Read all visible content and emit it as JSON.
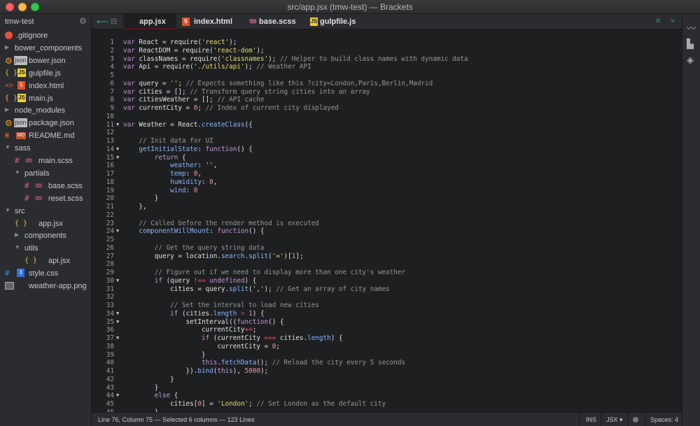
{
  "window": {
    "title": "src/app.jsx (tmw-test) — Brackets"
  },
  "sidebar": {
    "project": "tmw-test",
    "items": [
      {
        "label": ".gitignore",
        "icon": "git-icon"
      },
      {
        "label": "bower_components",
        "icon": "folder-closed"
      },
      {
        "label": "bower.json",
        "icon": "json-icon",
        "badge": "json"
      },
      {
        "label": "gulpfile.js",
        "icon": "js-icon",
        "badge": "JS"
      },
      {
        "label": "index.html",
        "icon": "html-icon",
        "badge": "<>"
      },
      {
        "label": "main.js",
        "icon": "js-icon",
        "badge": "JS"
      },
      {
        "label": "node_modules",
        "icon": "folder-closed"
      },
      {
        "label": "package.json",
        "icon": "json-icon",
        "badge": "json"
      },
      {
        "label": "README.md",
        "icon": "markdown-icon",
        "badge": "MD"
      },
      {
        "label": "sass",
        "icon": "folder-open"
      },
      {
        "label": "main.scss",
        "icon": "sass-icon"
      },
      {
        "label": "partials",
        "icon": "folder-open"
      },
      {
        "label": "base.scss",
        "icon": "sass-icon"
      },
      {
        "label": "reset.scss",
        "icon": "sass-icon"
      },
      {
        "label": "src",
        "icon": "folder-open"
      },
      {
        "label": "app.jsx",
        "icon": "jsx-icon"
      },
      {
        "label": "components",
        "icon": "folder-closed"
      },
      {
        "label": "utils",
        "icon": "folder-open"
      },
      {
        "label": "api.jsx",
        "icon": "jsx-icon"
      },
      {
        "label": "style.css",
        "icon": "css-icon"
      },
      {
        "label": "weather-app.png",
        "icon": "image-icon"
      }
    ]
  },
  "tabs": [
    {
      "label": "app.jsx",
      "active": true
    },
    {
      "label": "index.html",
      "active": false
    },
    {
      "label": "base.scss",
      "active": false
    },
    {
      "label": "gulpfile.js",
      "active": false
    }
  ],
  "editor": {
    "lines": [
      {
        "n": "1",
        "fold": "",
        "html": "<span class='k'>var</span> React = require(<span class='s'>'react'</span>);"
      },
      {
        "n": "2",
        "fold": "",
        "html": "<span class='k'>var</span> ReactDOM = require(<span class='s'>'react-dom'</span>);"
      },
      {
        "n": "3",
        "fold": "",
        "html": "<span class='k'>var</span> classNames = require(<span class='s'>'classnames'</span>); <span class='c'>// Helper to build class names with dynamic data</span>"
      },
      {
        "n": "4",
        "fold": "",
        "html": "<span class='k'>var</span> Api = require(<span class='s'>'./utils/api'</span>); <span class='c'>// Weather API</span>"
      },
      {
        "n": "5",
        "fold": "",
        "html": ""
      },
      {
        "n": "6",
        "fold": "",
        "html": "<span class='k'>var</span> query = <span class='s'>''</span>; <span class='c'>// Expects something like this ?city=London,Paris,Berlin,Madrid</span>"
      },
      {
        "n": "7",
        "fold": "",
        "html": "<span class='k'>var</span> cities = []; <span class='c'>// Transform query string cities into an array</span>"
      },
      {
        "n": "8",
        "fold": "",
        "html": "<span class='k'>var</span> citiesWeather = []; <span class='c'>// API cache</span>"
      },
      {
        "n": "9",
        "fold": "",
        "html": "<span class='k'>var</span> currentCity = <span class='n'>0</span>; <span class='c'>// Index of current city displayed</span>"
      },
      {
        "n": "10",
        "fold": "",
        "html": ""
      },
      {
        "n": "11",
        "fold": "▼",
        "html": "<span class='k'>var</span> Weather = React.<span class='f'>createClass</span>({"
      },
      {
        "n": "12",
        "fold": "",
        "html": ""
      },
      {
        "n": "13",
        "fold": "",
        "html": "    <span class='c'>// Init data for UI</span>"
      },
      {
        "n": "14",
        "fold": "▼",
        "html": "    <span class='f'>getInitialState</span>: <span class='k'>function</span>() {"
      },
      {
        "n": "15",
        "fold": "▼",
        "html": "        <span class='k'>return</span> {"
      },
      {
        "n": "16",
        "fold": "",
        "html": "            <span class='f'>weather</span>: <span class='s'>''</span>,"
      },
      {
        "n": "17",
        "fold": "",
        "html": "            <span class='f'>temp</span>: <span class='n'>0</span>,"
      },
      {
        "n": "18",
        "fold": "",
        "html": "            <span class='f'>humidity</span>: <span class='n'>0</span>,"
      },
      {
        "n": "19",
        "fold": "",
        "html": "            <span class='f'>wind</span>: <span class='n'>0</span>"
      },
      {
        "n": "20",
        "fold": "",
        "html": "        }"
      },
      {
        "n": "21",
        "fold": "",
        "html": "    },"
      },
      {
        "n": "22",
        "fold": "",
        "html": ""
      },
      {
        "n": "23",
        "fold": "",
        "html": "    <span class='c'>// Called before the render method is executed</span>"
      },
      {
        "n": "24",
        "fold": "▼",
        "html": "    <span class='f'>componentWillMount</span>: <span class='k'>function</span>() {"
      },
      {
        "n": "25",
        "fold": "",
        "html": ""
      },
      {
        "n": "26",
        "fold": "",
        "html": "        <span class='c'>// Get the query string data</span>"
      },
      {
        "n": "27",
        "fold": "",
        "html": "        query = location.<span class='f'>search</span>.<span class='f'>split</span>(<span class='s'>'='</span>)[<span class='n'>1</span>];"
      },
      {
        "n": "28",
        "fold": "",
        "html": ""
      },
      {
        "n": "29",
        "fold": "",
        "html": "        <span class='c'>// Figure out if we need to display more than one city's weather</span>"
      },
      {
        "n": "30",
        "fold": "▼",
        "html": "        <span class='k'>if</span> (query <span class='o'>!==</span> <span class='k'>undefined</span>) {"
      },
      {
        "n": "31",
        "fold": "",
        "html": "            cities = query.<span class='f'>split</span>(<span class='s'>','</span>); <span class='c'>// Get an array of city names</span>"
      },
      {
        "n": "32",
        "fold": "",
        "html": ""
      },
      {
        "n": "33",
        "fold": "",
        "html": "            <span class='c'>// Set the interval to load new cities</span>"
      },
      {
        "n": "34",
        "fold": "▼",
        "html": "            <span class='k'>if</span> (cities.<span class='f'>length</span> <span class='o'>&gt;</span> <span class='n'>1</span>) {"
      },
      {
        "n": "35",
        "fold": "▼",
        "html": "                setInterval((<span class='k'>function</span>() {"
      },
      {
        "n": "36",
        "fold": "",
        "html": "                    currentCity<span class='o'>++</span>;"
      },
      {
        "n": "37",
        "fold": "▼",
        "html": "                    <span class='k'>if</span> (currentCity <span class='o'>===</span> cities.<span class='f'>length</span>) {"
      },
      {
        "n": "38",
        "fold": "",
        "html": "                        currentCity = <span class='n'>0</span>;"
      },
      {
        "n": "39",
        "fold": "",
        "html": "                    }"
      },
      {
        "n": "40",
        "fold": "",
        "html": "                    <span class='k'>this</span>.<span class='f'>fetchData</span>(); <span class='c'>// Reload the city every 5 seconds</span>"
      },
      {
        "n": "41",
        "fold": "",
        "html": "                }).<span class='f'>bind</span>(<span class='k'>this</span>), <span class='n'>5000</span>);"
      },
      {
        "n": "42",
        "fold": "",
        "html": "            }"
      },
      {
        "n": "43",
        "fold": "",
        "html": "        }"
      },
      {
        "n": "44",
        "fold": "▼",
        "html": "        <span class='k'>else</span> {"
      },
      {
        "n": "45",
        "fold": "",
        "html": "            cities[<span class='n'>0</span>] = <span class='s'>'London'</span>; <span class='c'>// Set London as the default city</span>"
      },
      {
        "n": "46",
        "fold": "",
        "html": "        }"
      }
    ]
  },
  "status": {
    "cursor": "Line 76, Column 75 — Selected 6 columns — 123 Lines",
    "mode": "INS",
    "language": "JSX ▾",
    "spaces": "Spaces: 4"
  },
  "colors": {
    "background": "#1d1f21",
    "panel": "#2b2c2f",
    "keyword": "#c397d8",
    "string": "#e6db74",
    "comment": "#969896"
  }
}
